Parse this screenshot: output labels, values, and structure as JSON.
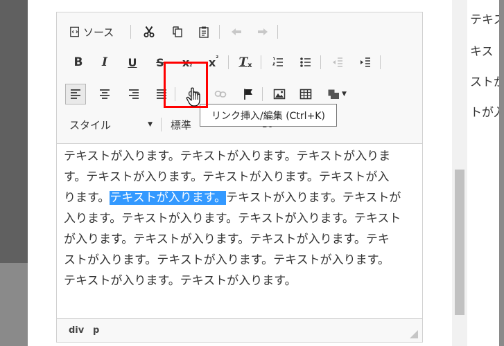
{
  "toolbar": {
    "row1": {
      "source_label": "ソース"
    },
    "row2": {
      "bold": "B",
      "italic": "I",
      "underline": "U",
      "strike": "S",
      "subscript": "x",
      "subscript_mark": "₂",
      "superscript": "x",
      "superscript_mark": "²",
      "remove_format": "T",
      "remove_format_mark": "x"
    },
    "row4": {
      "style_label": "スタイル",
      "format_label": "標準",
      "extra_label": "B0"
    }
  },
  "tooltip": {
    "text": "リンク挿入/編集 (Ctrl+K)"
  },
  "content": {
    "lines": [
      "テキストが入ります。テキストが入ります。テキストが入りま",
      "す。テキストが入ります。テキストが入ります。テキストが入"
    ],
    "line3_before": "ります。",
    "line3_selected": "テキストが入ります。",
    "line3_after": "テキストが入ります。テキストが",
    "lines_after": [
      "入ります。テキストが入ります。テキストが入ります。テキスト",
      "が入ります。テキストが入ります。テキストが入ります。テキ",
      "ストが入ります。テキストが入ります。テキストが入ります。",
      "テキストが入ります。テキストが入ります。"
    ]
  },
  "statusbar": {
    "path": [
      "div",
      "p"
    ]
  },
  "background_right": {
    "lines": [
      "テキス",
      "キス",
      "ストが",
      "トが入"
    ]
  },
  "colors": {
    "selection": "#3399ff",
    "focus_box": "#ff0000",
    "toolbar_bg": "#f8f8f8"
  },
  "icons": {
    "source": "source-document-icon",
    "cut": "scissors-icon",
    "copy": "copy-icon",
    "paste": "clipboard-icon",
    "undo": "undo-arrow-icon",
    "redo": "redo-arrow-icon",
    "link": "link-icon",
    "unlink": "unlink-icon",
    "anchor": "flag-icon",
    "image": "image-icon",
    "table": "table-icon",
    "template": "template-block-icon"
  }
}
